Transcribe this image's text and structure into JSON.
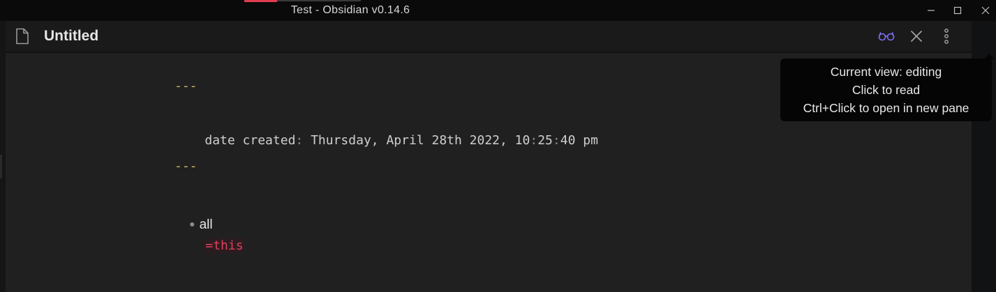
{
  "window": {
    "title": "Test - Obsidian v0.14.6",
    "controls": [
      "minimize-icon",
      "maximize-icon",
      "close-icon"
    ]
  },
  "pane": {
    "title": "Untitled",
    "header_actions": [
      {
        "icon": "glasses-icon",
        "color": "#7f6df2"
      },
      {
        "icon": "close-icon"
      },
      {
        "icon": "more-vertical-icon"
      }
    ]
  },
  "editor": {
    "frontmatter_open": "---",
    "frontmatter_key": "date created",
    "frontmatter_colon": ":",
    "frontmatter_value_a": " Thursday, April 28th 2022, 10",
    "frontmatter_value_sep1": ":",
    "frontmatter_value_b": "25",
    "frontmatter_value_sep2": ":",
    "frontmatter_value_c": "40 pm",
    "frontmatter_close": "---",
    "bullet_text": "all",
    "code_text": "=this"
  },
  "tooltip": {
    "line1": "Current view: editing",
    "line2": "Click to read",
    "line3": "Ctrl+Click to open in new pane"
  },
  "colors": {
    "accent": "#7f6df2",
    "frontmatter_dash": "#c9b968",
    "inline_code": "#e0405c"
  }
}
